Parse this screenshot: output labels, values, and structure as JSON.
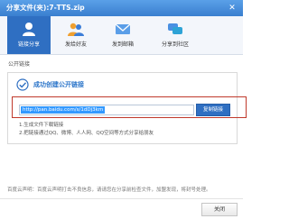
{
  "window": {
    "title": "分享文件(夹):7-TTS.zip",
    "close_glyph": "✕"
  },
  "tabs": [
    {
      "label": "链接分享",
      "icon": "link-icon",
      "active": true
    },
    {
      "label": "发给好友",
      "icon": "friends-icon",
      "active": false
    },
    {
      "label": "发到邮箱",
      "icon": "mail-icon",
      "active": false
    },
    {
      "label": "分享到社区",
      "icon": "community-icon",
      "active": false
    }
  ],
  "section_label": "公开链接",
  "panel": {
    "success_text": "成功创建公开链接",
    "url": "http://pan.baidu.com/s/1dDj3km",
    "copy_button": "复制链接",
    "tips": [
      "1.生成文件下载链接",
      "2.把链接通过QQ、微博、人人网、QQ空间等方式分享给朋友"
    ]
  },
  "footer_note": "百度云声明：百度云声明打击不良信息，请请您在分享前检查文件，加盟发现，将封号处理。",
  "close_button": "关闭",
  "colors": {
    "titlebar": "#3a7fcf",
    "accent": "#2f6fc2",
    "highlight_box": "#c0392b",
    "selection": "#3399ff"
  }
}
